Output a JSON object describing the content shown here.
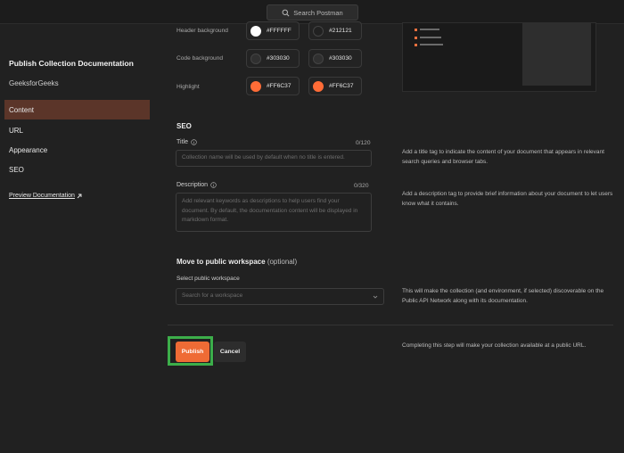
{
  "topbar": {
    "search_placeholder": "Search Postman"
  },
  "sidebar": {
    "title": "Publish Collection Documentation",
    "team": "GeeksforGeeks",
    "items": [
      {
        "label": "Content",
        "active": true
      },
      {
        "label": "URL",
        "active": false
      },
      {
        "label": "Appearance",
        "active": false
      },
      {
        "label": "SEO",
        "active": false
      }
    ],
    "preview_link": "Preview Documentation",
    "preview_link_icon": "external-link-arrow-icon"
  },
  "appearance": {
    "header_background": {
      "label": "Header background",
      "light": "#FFFFFF",
      "dark": "#212121"
    },
    "code_background": {
      "label": "Code background",
      "light": "#303030",
      "dark": "#303030"
    },
    "highlight": {
      "label": "Highlight",
      "light": "#FF6C37",
      "dark": "#FF6C37"
    }
  },
  "seo": {
    "heading": "SEO",
    "title_label": "Title",
    "title_count": "0/120",
    "title_placeholder": "Collection name will be used by default when no title is entered.",
    "title_help": "Add a title tag to indicate the content of your document that appears in relevant search queries and browser tabs.",
    "description_label": "Description",
    "description_count": "0/320",
    "description_placeholder": "Add relevant keywords as descriptions to help users find your document. By default, the documentation content will be displayed in markdown format.",
    "description_help": "Add a description tag to provide brief information about your document to let users know what it contains."
  },
  "workspace": {
    "heading": "Move to public workspace",
    "heading_optional": "(optional)",
    "select_label": "Select public workspace",
    "select_placeholder": "Search for a workspace",
    "help": "This will make the collection (and environment, if selected) discoverable on the Public API Network along with its documentation."
  },
  "actions": {
    "publish_label": "Publish",
    "cancel_label": "Cancel",
    "note": "Completing this step will make your collection available at a public URL."
  },
  "colors": {
    "accent": "#EF6B35",
    "active_nav": "#5B3529",
    "highlight_outline": "#3CAE4A",
    "background": "#212121"
  }
}
